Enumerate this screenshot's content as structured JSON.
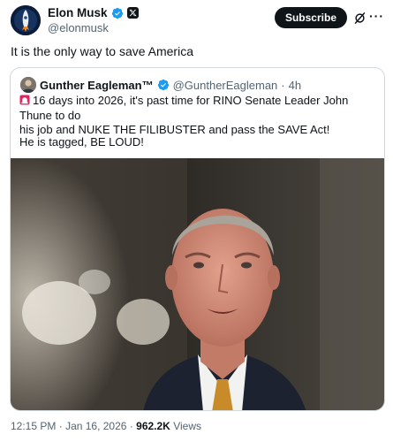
{
  "author": {
    "display_name": "Elon Musk",
    "handle": "@elonmusk",
    "avatar_icon": "rocket-avatar",
    "verified_icon": "verified-badge-icon",
    "affiliate_icon": "x-logo-icon"
  },
  "actions": {
    "subscribe_label": "Subscribe",
    "grok_icon": "grok-icon",
    "more_icon": "more-icon",
    "more_glyph": "···"
  },
  "tweet": {
    "text": "It is the only way to save America",
    "time": "12:15 PM",
    "separator": "·",
    "date": "Jan 16, 2026",
    "views_count": "962.2K",
    "views_label": "Views"
  },
  "quote": {
    "display_name": "Gunther Eagleman™",
    "handle": "@GuntherEagleman",
    "separator": "·",
    "age": "4h",
    "line_1": "16 days into 2026, it's past time for RINO Senate Leader John Thune to do",
    "line_2": "his job and NUKE THE FILIBUSTER and pass the SAVE Act!",
    "line_3": "He is tagged,  BE LOUD!",
    "emoji_icon": "siren-icon"
  },
  "colors": {
    "text": "#0f1419",
    "muted": "#536471",
    "border": "#cfd9de",
    "verified_blue": "#1d9bf0",
    "button_bg": "#0f1419"
  }
}
